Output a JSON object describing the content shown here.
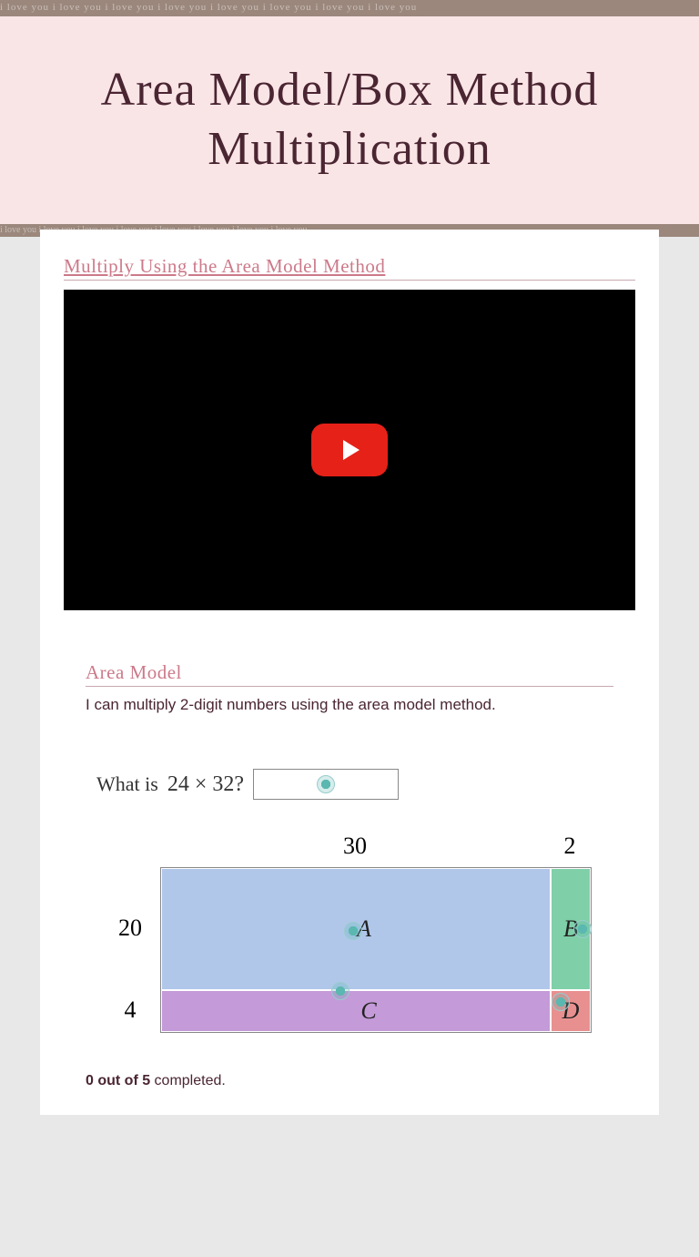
{
  "header": {
    "title": "Area Model/Box Method Multiplication"
  },
  "section1": {
    "link_text": "Multiply Using the Area Model Method"
  },
  "section2": {
    "title": "Area Model",
    "goal": "I can multiply 2-digit numbers using the area model method."
  },
  "problem": {
    "prompt_prefix": "What is ",
    "expression": "24 × 32?",
    "col_labels": {
      "left": "30",
      "right": "2"
    },
    "row_labels": {
      "top": "20",
      "bottom": "4"
    },
    "cells": {
      "a": "A",
      "b": "B",
      "c": "C",
      "d": "D"
    }
  },
  "progress": {
    "bold": "0 out of 5",
    "rest": " completed."
  }
}
